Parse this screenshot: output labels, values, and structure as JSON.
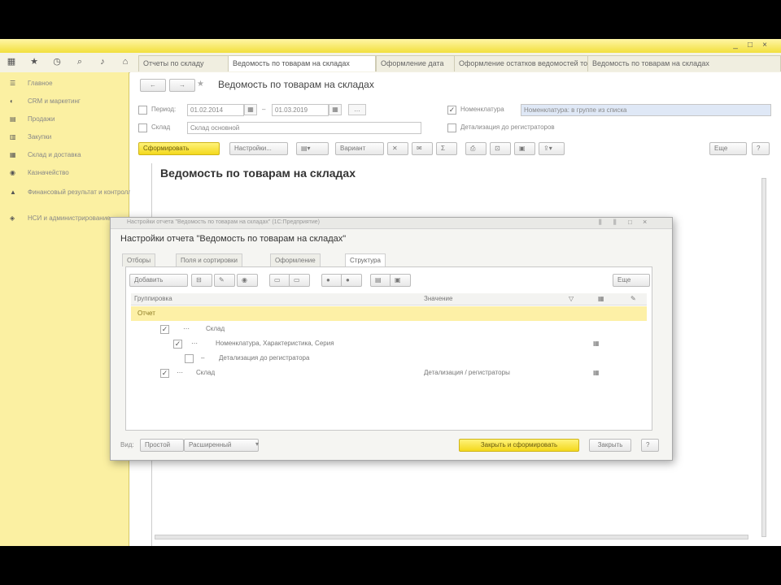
{
  "window": {
    "title": "",
    "controls": [
      "_",
      "□",
      "×"
    ]
  },
  "toolbar": {
    "icons": [
      "apps-grid-icon",
      "star-icon",
      "history-icon",
      "search-icon",
      "bell-icon",
      "home-icon"
    ],
    "tabs": [
      {
        "label": "Отчеты по складу"
      },
      {
        "label": "Ведомость по товарам на складах"
      },
      {
        "label": "Оформление дата"
      },
      {
        "label": "Оформление остатков ведомостей товаров"
      },
      {
        "label": "Ведомость по товарам на складах"
      }
    ]
  },
  "sidebar": {
    "items": [
      {
        "icon": "menu-icon",
        "label": "Главное"
      },
      {
        "icon": "crm-icon",
        "label": "CRM и маркетинг"
      },
      {
        "icon": "sales-icon",
        "label": "Продажи"
      },
      {
        "icon": "purchase-icon",
        "label": "Закупки"
      },
      {
        "icon": "warehouse-icon",
        "label": "Склад и доставка"
      },
      {
        "icon": "treasury-icon",
        "label": "Казначейство"
      },
      {
        "icon": "finance-icon",
        "label": "Финансовый результат и контроллинг"
      },
      {
        "icon": "nsi-icon",
        "label": "НСИ и администрирование"
      }
    ]
  },
  "report": {
    "title": "Ведомость по товарам на складах",
    "header_title": "Ведомость по товарам на складах",
    "period_label": "Период:",
    "date_from": "01.02.2014",
    "date_to": "01.03.2019",
    "warehouse_label": "Склад",
    "warehouse_value": "Склад основной",
    "nomenclature_label": "Номенклатура",
    "nomenclature_value": "Номенклатура: в группе из списка",
    "registration_label": "Детализация до регистраторов",
    "buttons": {
      "generate": "Сформировать",
      "settings": "Настройки...",
      "variant": "Вариант",
      "more": "Еще",
      "help": "?"
    }
  },
  "dialog": {
    "title_bar": "Настройки отчета \"Ведомость по товарам на складах\" (1С:Предприятие)",
    "heading": "Настройки отчета \"Ведомость по товарам на складах\"",
    "tabs": [
      {
        "label": "Отборы"
      },
      {
        "label": "Поля и сортировки"
      },
      {
        "label": "Оформление"
      },
      {
        "label": "Структура"
      }
    ],
    "panel_toolbar": {
      "add": "Добавить",
      "more": "Еще"
    },
    "columns": {
      "grouping": "Группировка",
      "value": "Значение"
    },
    "rows": [
      {
        "label": "Отчет",
        "value": ""
      },
      {
        "label": "Склад",
        "value": ""
      },
      {
        "label": "Номенклатура, Характеристика, Серия",
        "value": ""
      },
      {
        "label": "Детализация до регистратора",
        "value": ""
      },
      {
        "label": "Склад",
        "value": "Детализация / регистраторы"
      }
    ],
    "footer": {
      "label": "Вид:",
      "mode": "Простой",
      "dropdown": "Расширенный",
      "close_and_generate": "Закрыть и сформировать",
      "close": "Закрыть",
      "help": "?"
    }
  }
}
